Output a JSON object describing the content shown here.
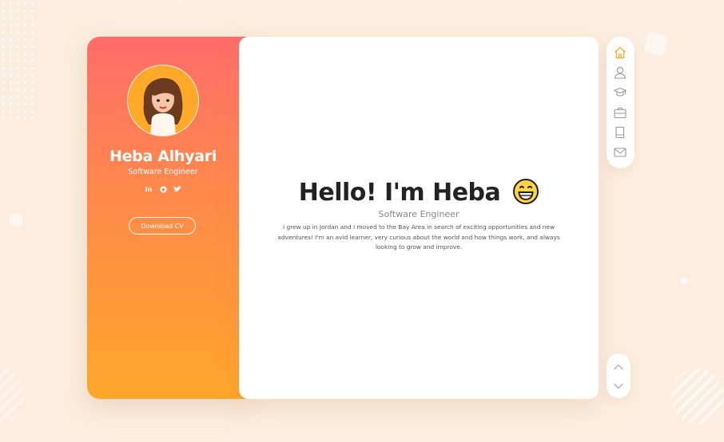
{
  "profile": {
    "name": "Heba Alhyari",
    "title": "Software Engineer",
    "download_label": "Download CV",
    "social": [
      {
        "icon": "linkedin-icon",
        "glyph": "in"
      },
      {
        "icon": "github-icon",
        "glyph": "◕"
      },
      {
        "icon": "twitter-icon",
        "glyph": "✦"
      }
    ]
  },
  "main": {
    "headline": "Hello! I'm Heba",
    "headline_emoji": "grinning-face-emoji",
    "subtitle": "Software Engineer",
    "bio": "I grew up in Jordan and I moved to the Bay Area in search of exciting opportunities and new adventures! I'm an avid learner, very curious about the world and how things work, and always looking to grow and improve."
  },
  "nav": {
    "items": [
      {
        "icon": "home-icon",
        "active": true
      },
      {
        "icon": "user-icon",
        "active": false
      },
      {
        "icon": "graduation-cap-icon",
        "active": false
      },
      {
        "icon": "briefcase-icon",
        "active": false
      },
      {
        "icon": "book-icon",
        "active": false
      },
      {
        "icon": "envelope-icon",
        "active": false
      }
    ]
  },
  "pager": {
    "up_icon": "chevron-up-icon",
    "down_icon": "chevron-down-icon"
  },
  "colors": {
    "accent": "#ffa629",
    "gradient_top": "#ff6d6a",
    "gradient_bottom": "#ffa629",
    "background": "#fbeee0"
  }
}
